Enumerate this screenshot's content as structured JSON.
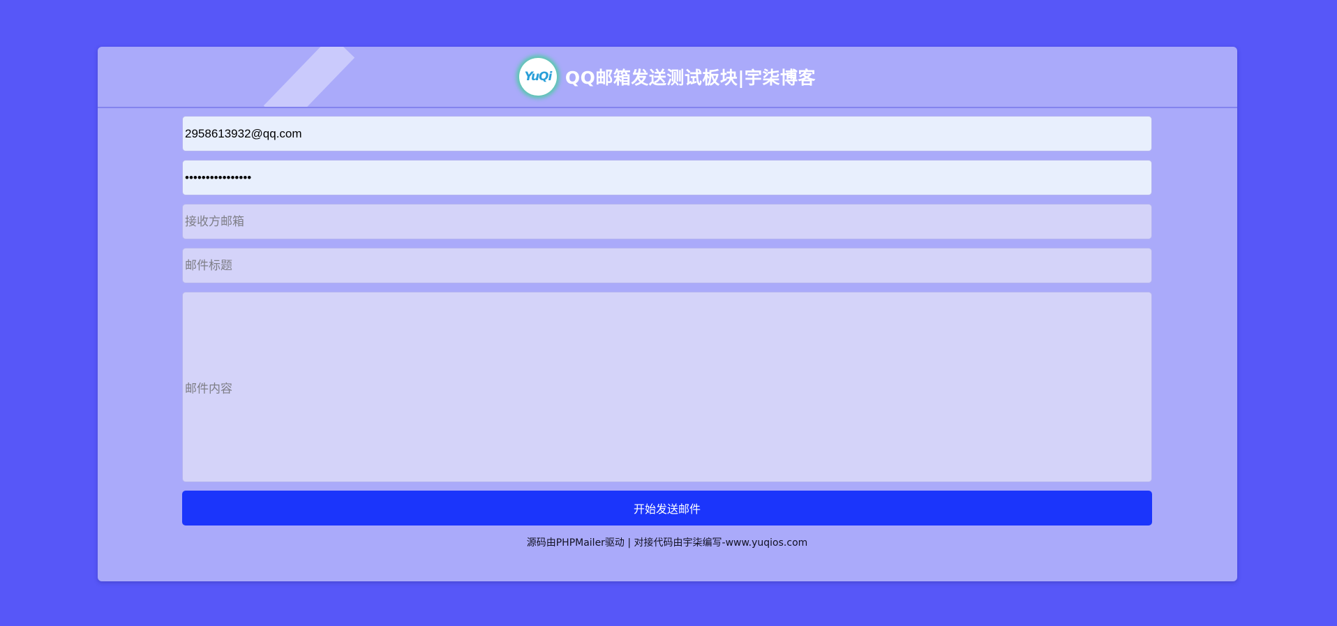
{
  "header": {
    "logo_text": "YuQi",
    "title": "QQ邮箱发送测试板块|宇柒博客"
  },
  "form": {
    "sender_email": {
      "value": "2958613932@qq.com"
    },
    "password": {
      "value": "••••••••••••••••"
    },
    "recipient": {
      "placeholder": "接收方邮箱",
      "value": ""
    },
    "subject": {
      "placeholder": "邮件标题",
      "value": ""
    },
    "content": {
      "placeholder": "邮件内容",
      "value": ""
    },
    "submit_label": "开始发送邮件"
  },
  "footer": {
    "text": "源码由PHPMailer驱动 | 对接代码由宇柒编写-www.yuqios.com"
  },
  "colors": {
    "page_background": "#5757f8",
    "card_background": "#aaaafa",
    "filled_input": "#e8effd",
    "empty_input": "#d4d3f9",
    "submit_button": "#1b35fb",
    "logo_glow": "#3ed296",
    "logo_text": "#2a9fd8"
  },
  "icons": {
    "logo": "yuqi-logo-icon"
  }
}
